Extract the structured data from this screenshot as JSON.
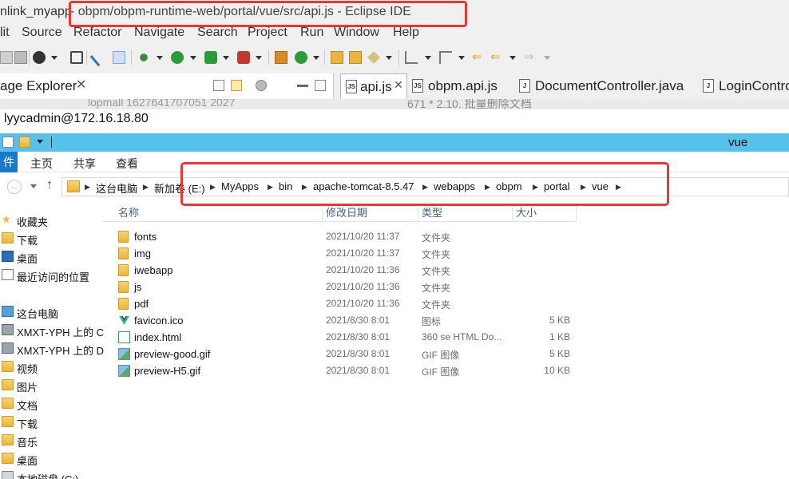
{
  "eclipse": {
    "title_project": "nlink_myapp",
    "title_path": "- obpm/obpm-runtime-web/portal/vue/src/api.js - Eclipse IDE",
    "menu": [
      "lit",
      "Source",
      "Refactor",
      "Navigate",
      "Search",
      "Project",
      "Run",
      "Window",
      "Help"
    ],
    "package_explorer_label": "age Explorer",
    "package_explorer_close": "✕",
    "editor_tabs": [
      "api.js",
      "obpm.api.js",
      "DocumentController.java",
      "LoginContro"
    ],
    "active_tab_close": "✕",
    "tab_badges": [
      "JS",
      "JS",
      "J",
      "J"
    ],
    "ghost_line": "671    * 2.10. 批量删除文档",
    "ghost_left": "lopmall 1627641707051 2027",
    "highlight_color": "#e53935"
  },
  "remote_session": {
    "title": "lyycadmin@172.16.18.80"
  },
  "explorer": {
    "window_folder": "vue",
    "ribbon": {
      "file": "件",
      "home": "主页",
      "share": "共享",
      "view": "查看"
    },
    "nav_back_glyph": "←",
    "nav_up_glyph": "↑",
    "breadcrumb": [
      "这台电脑",
      "新加卷 (E:)",
      "MyApps",
      "bin",
      "apache-tomcat-8.5.47",
      "webapps",
      "obpm",
      "portal",
      "vue"
    ],
    "breadcrumb_sep": "▶",
    "nav_pane": [
      {
        "label": "收藏夹",
        "icon": "star-icon"
      },
      {
        "label": "下载",
        "icon": "download-folder-icon"
      },
      {
        "label": "桌面",
        "icon": "desktop-icon"
      },
      {
        "label": "最近访问的位置",
        "icon": "recent-places-icon"
      },
      {
        "label": "这台电脑",
        "icon": "computer-icon"
      },
      {
        "label": "XMXT-YPH 上的 C",
        "icon": "network-drive-icon"
      },
      {
        "label": "XMXT-YPH 上的 D",
        "icon": "network-drive-icon"
      },
      {
        "label": "视频",
        "icon": "video-folder-icon"
      },
      {
        "label": "图片",
        "icon": "pictures-folder-icon"
      },
      {
        "label": "文档",
        "icon": "documents-folder-icon"
      },
      {
        "label": "下载",
        "icon": "download-folder-icon"
      },
      {
        "label": "音乐",
        "icon": "music-folder-icon"
      },
      {
        "label": "桌面",
        "icon": "desktop-icon"
      },
      {
        "label": "本地磁盘 (C:)",
        "icon": "local-disk-icon"
      }
    ],
    "columns": [
      "名称",
      "修改日期",
      "类型",
      "大小"
    ],
    "files": [
      {
        "name": "fonts",
        "date": "2021/10/20 11:37",
        "type": "文件夹",
        "size": "",
        "icon": "folder-icon"
      },
      {
        "name": "img",
        "date": "2021/10/20 11:37",
        "type": "文件夹",
        "size": "",
        "icon": "folder-icon"
      },
      {
        "name": "iwebapp",
        "date": "2021/10/20 11:36",
        "type": "文件夹",
        "size": "",
        "icon": "folder-icon"
      },
      {
        "name": "js",
        "date": "2021/10/20 11:36",
        "type": "文件夹",
        "size": "",
        "icon": "folder-icon"
      },
      {
        "name": "pdf",
        "date": "2021/10/20 11:36",
        "type": "文件夹",
        "size": "",
        "icon": "folder-icon"
      },
      {
        "name": "favicon.ico",
        "date": "2021/8/30 8:01",
        "type": "图标",
        "size": "5 KB",
        "icon": "vue-logo-icon"
      },
      {
        "name": "index.html",
        "date": "2021/8/30 8:01",
        "type": "360 se HTML Do...",
        "size": "1 KB",
        "icon": "html-file-icon"
      },
      {
        "name": "preview-good.gif",
        "date": "2021/8/30 8:01",
        "type": "GIF 图像",
        "size": "5 KB",
        "icon": "gif-image-icon"
      },
      {
        "name": "preview-H5.gif",
        "date": "2021/8/30 8:01",
        "type": "GIF 图像",
        "size": "10 KB",
        "icon": "gif-image-icon"
      }
    ]
  }
}
